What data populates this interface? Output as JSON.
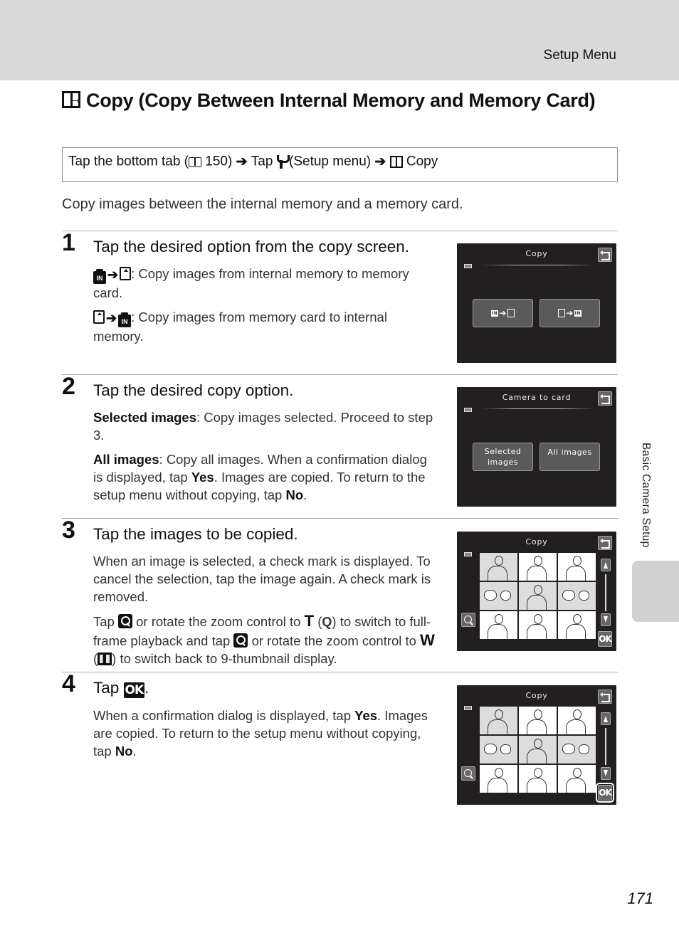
{
  "header": {
    "section": "Setup Menu"
  },
  "title": {
    "icon": "copy-icon",
    "text": "Copy (Copy Between Internal Memory and Memory Card)"
  },
  "nav": {
    "part1": "Tap the bottom tab (",
    "book_icon": "book-reference-icon",
    "page_ref": "150",
    "part2": ")",
    "arrow": "➔",
    "part3": "Tap",
    "wrench_icon": "setup-menu-wrench-icon",
    "part4": "(Setup menu)",
    "part5": "Copy"
  },
  "intro": "Copy images between the internal memory and a memory card.",
  "steps": [
    {
      "num": "1",
      "title": "Tap the desired option from the copy screen.",
      "items": [
        {
          "text": ": Copy images from internal memory to memory card.",
          "glyph": "internal-to-card"
        },
        {
          "text": ": Copy images from memory card to internal memory.",
          "glyph": "card-to-internal"
        }
      ],
      "screen": {
        "title": "Copy",
        "btn_left": "internal-to-card",
        "btn_right": "card-to-internal"
      }
    },
    {
      "num": "2",
      "title": "Tap the desired copy option.",
      "p1_bold": "Selected images",
      "p1_text": ": Copy images selected. Proceed to step 3.",
      "p2_bold": "All images",
      "p2_text1": ": Copy all images. When a confirmation dialog is displayed, tap ",
      "p2_yes": "Yes",
      "p2_text2": ". Images are copied. To return to the setup menu without copying, tap ",
      "p2_no": "No",
      "p2_end": ".",
      "screen": {
        "title": "Camera to card",
        "btn_left": "Selected images",
        "btn_right": "All images"
      }
    },
    {
      "num": "3",
      "title": "Tap the images to be copied.",
      "p1": "When an image is selected, a check mark is displayed. To cancel the selection, tap the image again. A check mark is removed.",
      "p2_a": "Tap ",
      "p2_b": " or rotate the zoom control to ",
      "p2_T": "T",
      "p2_c": " (",
      "p2_q": "Q",
      "p2_d": ") to switch to full-frame playback and tap ",
      "p2_e": " or rotate the zoom control to ",
      "p2_W": "W",
      "p2_f": " (",
      "p2_g": ") to switch back to 9-thumbnail display.",
      "screen": {
        "title": "Copy",
        "ok": "OK"
      }
    },
    {
      "num": "4",
      "title_a": "Tap ",
      "title_ok": "OK",
      "title_end": ".",
      "p_a": "When a confirmation dialog is displayed, tap ",
      "p_yes": "Yes",
      "p_b": ". Images are copied. To return to the setup menu without copying, tap ",
      "p_no": "No",
      "p_end": ".",
      "screen": {
        "title": "Copy",
        "ok": "OK"
      }
    }
  ],
  "side_tab": "Basic Camera Setup",
  "page_number": "171"
}
